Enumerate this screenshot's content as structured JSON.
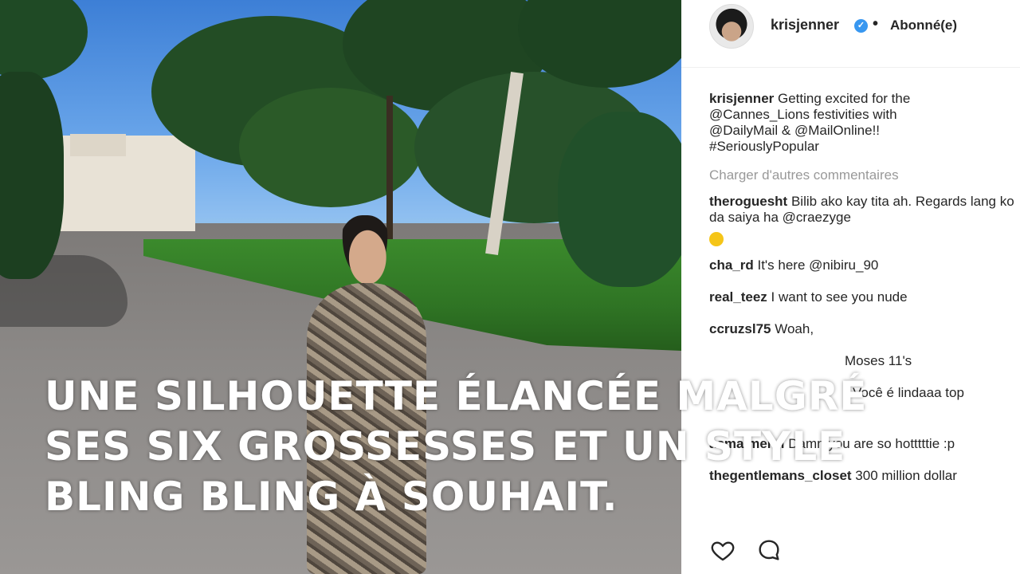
{
  "post": {
    "username": "krisjenner",
    "separator": "•",
    "follow_status": "Abonné(e)",
    "caption_text": "Getting excited for the @Cannes_Lions festivities with @DailyMail & @MailOnline!! #SeriouslyPopular",
    "load_more": "Charger d'autres commentaires"
  },
  "comments": [
    {
      "user": "theroguesht",
      "text": "Bilib ako kay tita ah. Regards lang ko da saiya ha @craezyge"
    },
    {
      "user": "cha_rd",
      "text": "It's here @nibiru_90"
    },
    {
      "user": "real_teez",
      "text": "I want to see you nude"
    },
    {
      "user": "ccruzsl75",
      "text": "Woah,"
    },
    {
      "user": "",
      "text": "Moses 11's"
    },
    {
      "user": "",
      "text": "Você é lindaaa top"
    },
    {
      "user": "asmalmehri",
      "text": "Damn you are so hotttttie :p"
    },
    {
      "user": "thegentlemans_closet",
      "text": "300 million dollar"
    }
  ],
  "overlay_caption": {
    "line1": "UNE SILHOUETTE ÉLANCÉE MALGRÉ",
    "line2": "SES SIX GROSSESSES ET UN STYLE",
    "line3": "BLING BLING À SOUHAIT."
  },
  "icons": {
    "verified": "verified-badge-icon",
    "like": "heart-icon",
    "comment": "speech-bubble-icon"
  },
  "colors": {
    "verified_blue": "#3897f0",
    "muted_text": "#999999",
    "body_text": "#262626"
  }
}
